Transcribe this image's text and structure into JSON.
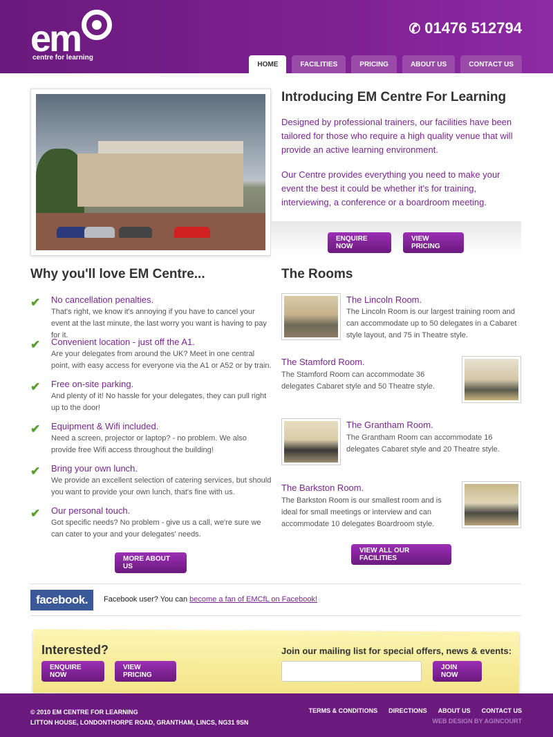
{
  "header": {
    "logo_text": "em",
    "logo_tagline": "centre for learning",
    "phone": "01476 512794",
    "nav": [
      "HOME",
      "FACILITIES",
      "PRICING",
      "ABOUT US",
      "CONTACT US"
    ]
  },
  "intro": {
    "title": "Introducing EM Centre For Learning",
    "p1": "Designed by professional trainers, our facilities have been tailored for those who require a high quality venue that will provide an active learning environment.",
    "p2": "Our Centre provides everything you need to make your event the best it could be whether it's for training, interviewing, a conference or a boardroom meeting.",
    "enquire_btn": "ENQUIRE NOW",
    "pricing_btn": "VIEW PRICING"
  },
  "why": {
    "title": "Why you'll love EM Centre...",
    "features": [
      {
        "title": "No cancellation penalties.",
        "desc": "That's right, we know it's annoying if you have to cancel your event at the last minute, the last worry you want is having to pay for it."
      },
      {
        "title": "Convenient location - just off the A1.",
        "desc": "Are your delegates from around the UK? Meet in one central point, with easy access for everyone via the A1 or A52 or by train."
      },
      {
        "title": "Free on-site parking.",
        "desc": "And plenty of it! No hassle for your delegates, they can pull right up to the door!"
      },
      {
        "title": "Equipment & Wifi included.",
        "desc": "Need a screen, projector or laptop? - no problem. We also provide free Wifi access throughout the building!"
      },
      {
        "title": "Bring your own lunch.",
        "desc": "We provide an excellent selection of catering services, but should you want to provide your own lunch, that's fine with us."
      },
      {
        "title": "Our personal touch.",
        "desc": "Got specific needs? No problem - give us a call, we're sure we can cater to your and your delegates' needs."
      }
    ],
    "more_btn": "MORE ABOUT US"
  },
  "rooms": {
    "title": "The Rooms",
    "items": [
      {
        "title": "The Lincoln Room.",
        "desc": "The Lincoln Room is our largest training room and can accommodate up to 50 delegates in a Cabaret style layout, and 75 in Theatre style."
      },
      {
        "title": "The Stamford Room.",
        "desc": "The Stamford Room can accommodate 36 delegates Cabaret style and 50 Theatre style."
      },
      {
        "title": "The Grantham Room.",
        "desc": "The Grantham Room can accommodate 16 delegates Cabaret style and 20 Theatre style."
      },
      {
        "title": "The Barkston Room.",
        "desc": "The Barkston Room is our smallest room and is ideal for small meetings or interview and can accommodate 10 delegates Boardroom style."
      }
    ],
    "all_btn": "VIEW ALL OUR FACILITIES"
  },
  "facebook": {
    "logo": "facebook.",
    "text": "Facebook user? You can ",
    "link": "become a fan of EMCfL on Facebook!"
  },
  "newsletter": {
    "title": "Interested?",
    "enquire_btn": "ENQUIRE NOW",
    "pricing_btn": "VIEW PRICING",
    "label": "Join our mailing list for special offers, news & events:",
    "email_placeholder": "",
    "join_btn": "JOIN NOW"
  },
  "footer": {
    "copyright": "© 2010 EM CENTRE FOR LEARNING",
    "address": "LITTON HOUSE, LONDONTHORPE ROAD, GRANTHAM, LINCS, NG31 9SN",
    "links": [
      "TERMS & CONDITIONS",
      "DIRECTIONS",
      "ABOUT US",
      "CONTACT US"
    ],
    "credit": "WEB DESIGN BY AGINCOURT"
  }
}
